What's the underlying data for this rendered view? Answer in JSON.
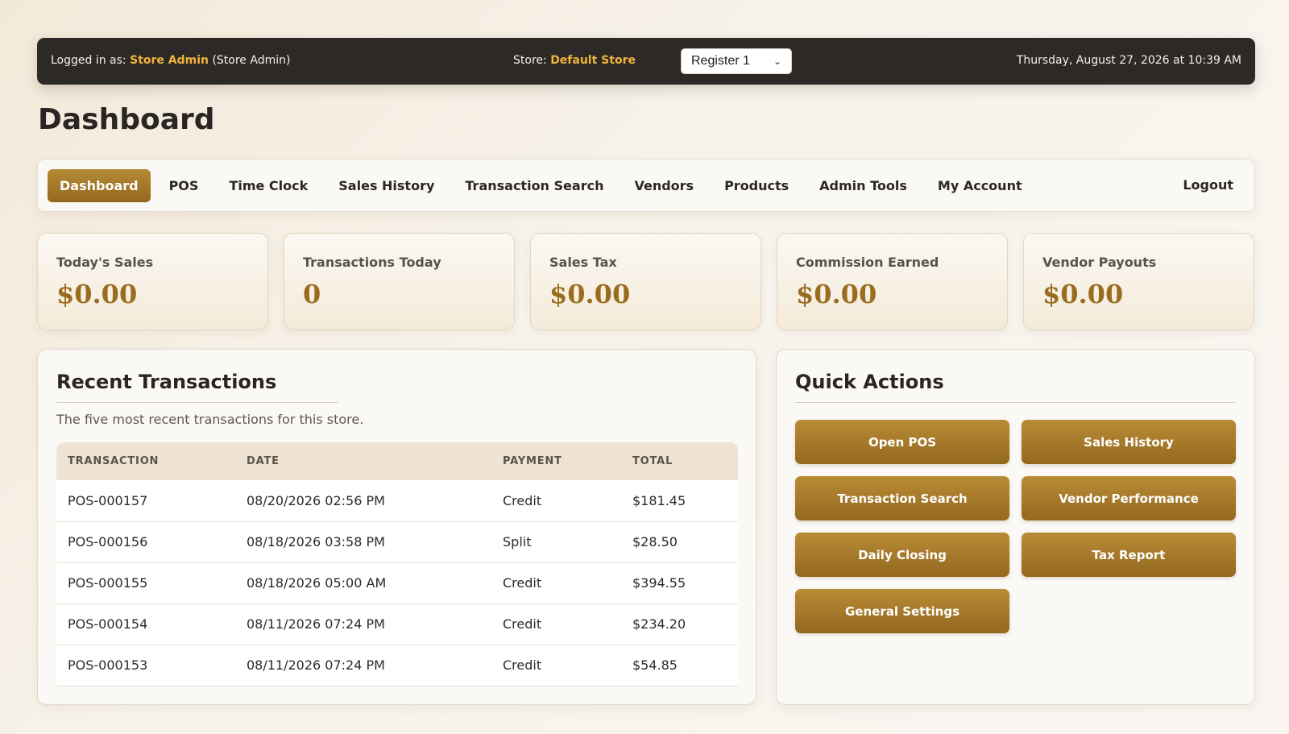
{
  "topbar": {
    "logged_in_label": "Logged in as:",
    "user_name": "Store Admin",
    "user_role": "(Store Admin)",
    "store_label": "Store:",
    "store_name": "Default Store",
    "register": "Register 1",
    "datetime": "Thursday, August 27, 2026 at 10:39 AM"
  },
  "page": {
    "title": "Dashboard"
  },
  "nav": {
    "items": [
      "Dashboard",
      "POS",
      "Time Clock",
      "Sales History",
      "Transaction Search",
      "Vendors",
      "Products",
      "Admin Tools",
      "My Account"
    ],
    "active": "Dashboard",
    "logout": "Logout"
  },
  "stats": [
    {
      "label": "Today's Sales",
      "value": "$0.00"
    },
    {
      "label": "Transactions Today",
      "value": "0"
    },
    {
      "label": "Sales Tax",
      "value": "$0.00"
    },
    {
      "label": "Commission Earned",
      "value": "$0.00"
    },
    {
      "label": "Vendor Payouts",
      "value": "$0.00"
    }
  ],
  "recent": {
    "title": "Recent Transactions",
    "description": "The five most recent transactions for this store.",
    "columns": [
      "TRANSACTION",
      "DATE",
      "PAYMENT",
      "TOTAL"
    ],
    "rows": [
      [
        "POS-000157",
        "08/20/2026 02:56 PM",
        "Credit",
        "$181.45"
      ],
      [
        "POS-000156",
        "08/18/2026 03:58 PM",
        "Split",
        "$28.50"
      ],
      [
        "POS-000155",
        "08/18/2026 05:00 AM",
        "Credit",
        "$394.55"
      ],
      [
        "POS-000154",
        "08/11/2026 07:24 PM",
        "Credit",
        "$234.20"
      ],
      [
        "POS-000153",
        "08/11/2026 07:24 PM",
        "Credit",
        "$54.85"
      ]
    ]
  },
  "quick": {
    "title": "Quick Actions",
    "actions": [
      "Open POS",
      "Sales History",
      "Transaction Search",
      "Vendor Performance",
      "Daily Closing",
      "Tax Report",
      "General Settings"
    ]
  },
  "colors": {
    "accent": "#9a6c1e",
    "topbar_bg": "#2d2926",
    "highlight": "#f0b43a"
  }
}
